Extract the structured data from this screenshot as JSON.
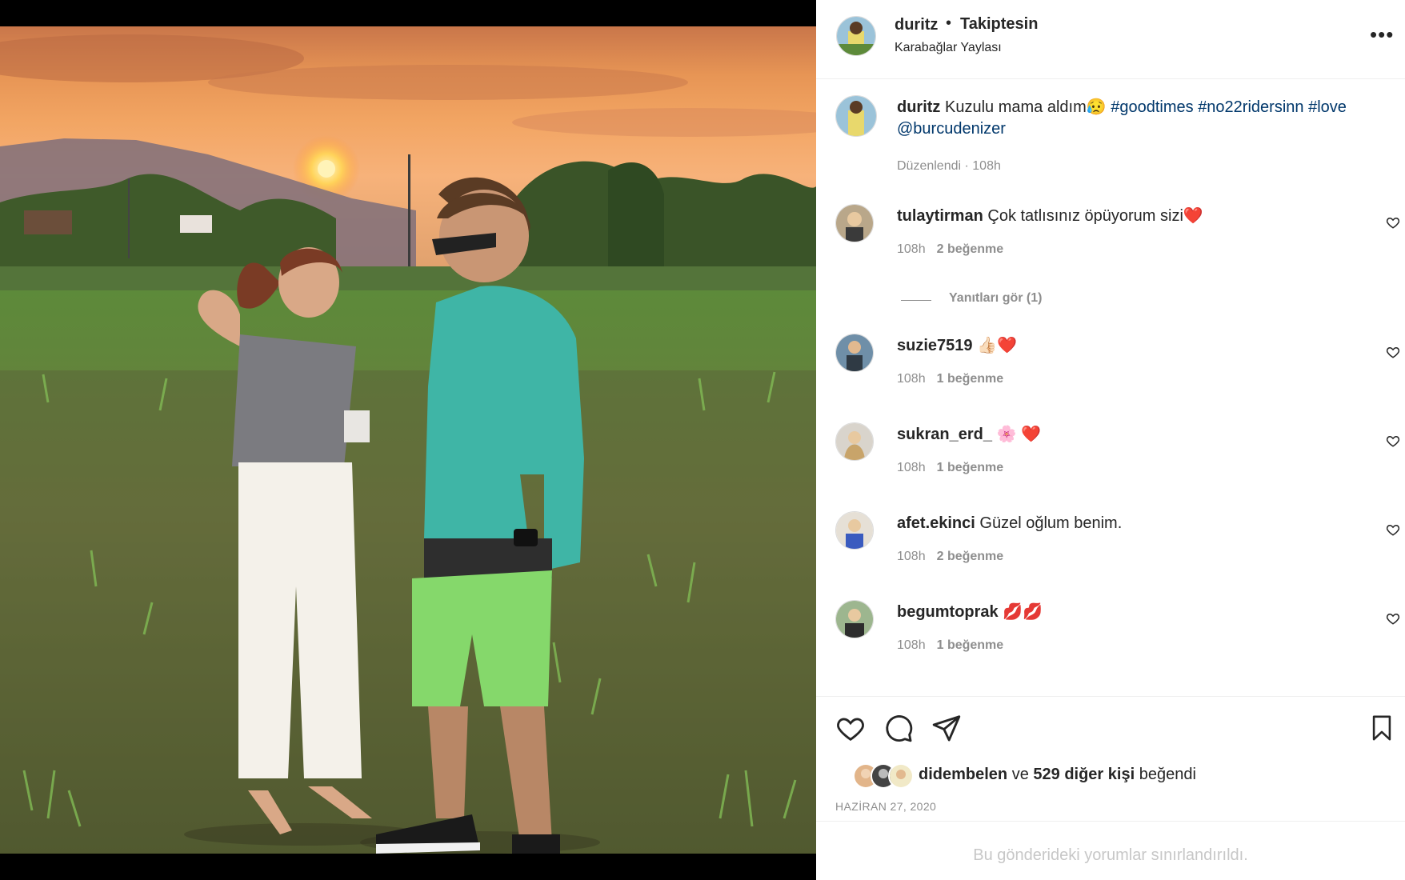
{
  "header": {
    "username": "duritz",
    "separator": "•",
    "follow_status": "Takiptesin",
    "location": "Karabağlar Yaylası",
    "more_label": "•••"
  },
  "caption": {
    "username": "duritz",
    "text": "Kuzulu mama aldım",
    "emoji": "😥",
    "hashtags": [
      "#goodtimes",
      "#no22ridersinn",
      "#love"
    ],
    "mention": "@burcudenizer",
    "edited": "Düzenlendi · 108h"
  },
  "comments": [
    {
      "username": "tulaytirman",
      "text": "Çok tatlısınız öpüyorum sizi",
      "emoji": "❤️",
      "time": "108h",
      "likes": "2 beğenme"
    },
    {
      "username": "suzie7519",
      "text": "",
      "emoji": "👍🏻❤️",
      "time": "108h",
      "likes": "1 beğenme"
    },
    {
      "username": "sukran_erd_",
      "text": "",
      "emoji": "🌸 ❤️",
      "time": "108h",
      "likes": "1 beğenme"
    },
    {
      "username": "afet.ekinci",
      "text": "Güzel oğlum benim.",
      "emoji": "",
      "time": "108h",
      "likes": "2 beğenme"
    },
    {
      "username": "begumtoprak",
      "text": "",
      "emoji": "💋💋",
      "time": "108h",
      "likes": "1 beğenme"
    }
  ],
  "view_replies": "Yanıtları gör (1)",
  "likes_line": {
    "first_user": "didembelen",
    "and": "ve",
    "others": "529 diğer kişi",
    "liked": "beğendi"
  },
  "post_date": "HAZİRAN 27, 2020",
  "comments_restricted": "Bu gönderideki yorumlar sınırlandırıldı.",
  "icons": {
    "like": "heart-icon",
    "comment": "comment-icon",
    "share": "share-icon",
    "save": "bookmark-icon",
    "more": "more-icon"
  }
}
